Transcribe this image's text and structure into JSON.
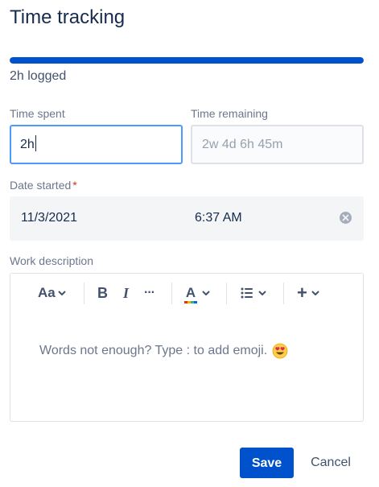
{
  "dialog": {
    "title": "Time tracking",
    "progress_fraction": 1.0,
    "logged_text": "2h logged"
  },
  "time_spent": {
    "label": "Time spent",
    "value": "2h"
  },
  "time_remaining": {
    "label": "Time remaining",
    "placeholder": "2w 4d 6h 45m"
  },
  "date_started": {
    "label": "Date started",
    "required_marker": "*",
    "date": "11/3/2021",
    "time": "6:37 AM",
    "clear_icon": "clear-circle-icon"
  },
  "work_description": {
    "label": "Work description",
    "toolbar": {
      "text_style_label": "Aa",
      "bold_label": "B",
      "italic_label": "I",
      "more_label": "···",
      "text_color_label": "A",
      "list_icon": "bullet-list-icon",
      "insert_label": "+"
    },
    "placeholder": "Words not enough? Type : to add emoji.",
    "emoji": "heart-eyes-emoji"
  },
  "actions": {
    "save_label": "Save",
    "cancel_label": "Cancel"
  },
  "colors": {
    "primary": "#0052cc",
    "focus_border": "#4c9aff",
    "required": "#de350b",
    "text": "#172b4d",
    "subtle_text": "#6b778c"
  }
}
